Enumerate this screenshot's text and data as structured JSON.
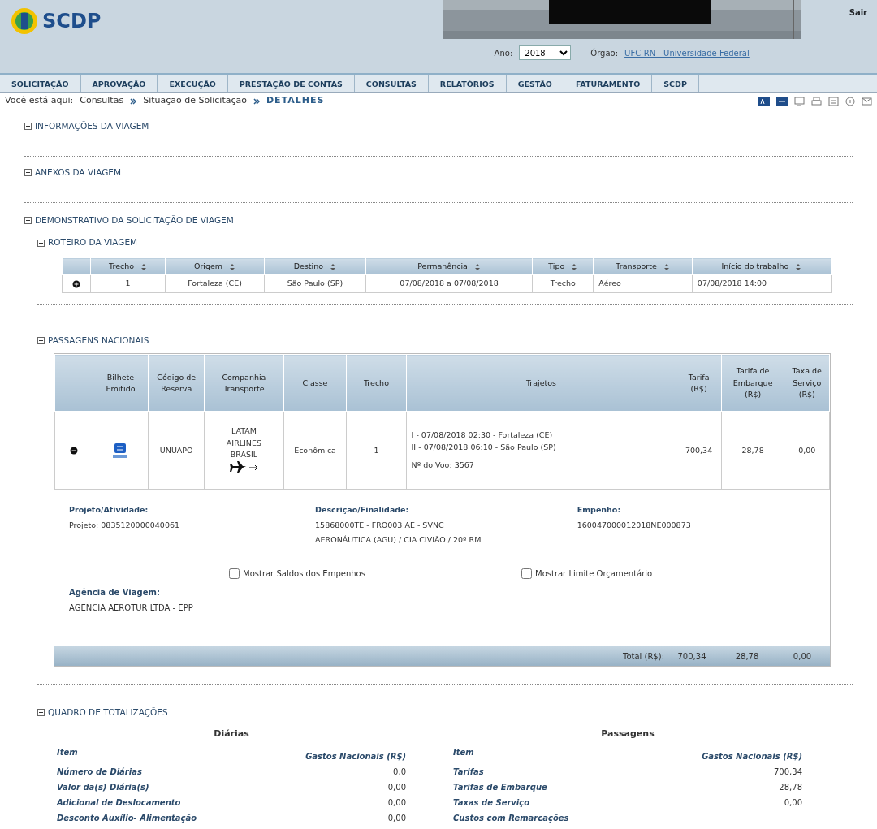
{
  "header": {
    "logo_text": "SCDP",
    "logout": "Sair",
    "year_label": "Ano:",
    "year": "2018",
    "org_label": "Órgão:",
    "org": "UFC-RN - Universidade Federal"
  },
  "menu": [
    "SOLICITAÇÃO",
    "APROVAÇÃO",
    "EXECUÇÃO",
    "PRESTAÇÃO DE CONTAS",
    "CONSULTAS",
    "RELATÓRIOS",
    "GESTÃO",
    "FATURAMENTO",
    "SCDP"
  ],
  "breadcrumb": {
    "label": "Você está aqui:",
    "items": [
      "Consultas",
      "Situação de Solicitação"
    ],
    "current": "DETALHES"
  },
  "sections": [
    {
      "title": "INFORMAÇÕES DA VIAGEM",
      "expanded": false
    },
    {
      "title": "ANEXOS DA VIAGEM",
      "expanded": false
    },
    {
      "title": "DEMONSTRATIVO DA SOLICITAÇÃO DE VIAGEM",
      "expanded": true
    }
  ],
  "itinerary": {
    "title": "ROTEIRO DA VIAGEM",
    "expanded": true,
    "columns": [
      "Trecho",
      "Origem",
      "Destino",
      "Permanência",
      "Tipo",
      "Transporte",
      "Início do trabalho"
    ],
    "rows": [
      {
        "expanded": false,
        "cells": [
          "1",
          "Fortaleza (CE)",
          "São Paulo (SP)",
          "07/08/2018 a 07/08/2018",
          "Trecho",
          "Aéreo",
          "07/08/2018 14:00"
        ]
      }
    ]
  },
  "tickets": {
    "title": "PASSAGENS NACIONAIS",
    "expanded": true,
    "columns": [
      "Bilhete Emitido",
      "Código de Reserva",
      "Companhia Transporte",
      "Classe",
      "Trecho",
      "Trajetos",
      "Tarifa (R$)",
      "Tarifa de Embarque (R$)",
      "Taxa de Serviço (R$)"
    ],
    "rows": [
      {
        "expanded": true,
        "issued": true,
        "code": "UNUAPO",
        "company": "LATAM AIRLINES BRASIL",
        "class": "Econômica",
        "leg": "1",
        "routes": [
          "I - 07/08/2018 02:30 - Fortaleza (CE)",
          "II - 07/08/2018 06:10 - São Paulo (SP)"
        ],
        "flight": "Nº do Voo: 3567",
        "fare": "700,34",
        "boarding": "28,78",
        "service": "0,00"
      }
    ],
    "details": [
      {
        "label": "Projeto/Atividade:",
        "lines": [
          "Projeto: 0835120000040061"
        ]
      },
      {
        "label": "Descrição/Finalidade:",
        "lines": [
          "15868000TE - FRO003 AE - SVNC",
          "AERONÁUTICA (AGU) / CIA CIVIÃO / 20º RM"
        ]
      },
      {
        "label": "Empenho:",
        "lines": [
          "160047000012018NE000873"
        ]
      }
    ],
    "checks": [
      {
        "label": "Mostrar Saldos dos Empenhos",
        "checked": false
      },
      {
        "label": "Mostrar Limite Orçamentário",
        "checked": false
      }
    ],
    "agency_label": "Agência de Viagem:",
    "agency": "AGENCIA AEROTUR LTDA - EPP",
    "total_label": "Total (R$):",
    "totals": [
      "700,34",
      "28,78",
      "0,00"
    ]
  },
  "summary": {
    "title": "QUADRO DE TOTALIZAÇÕES",
    "expanded": true,
    "groups": [
      {
        "title": "Diárias",
        "item_header": "Item",
        "value_header": "Gastos Nacionais (R$)",
        "rows": [
          {
            "item": "Número de Diárias",
            "value": "0,0"
          },
          {
            "item": "Valor da(s) Diária(s)",
            "value": "0,00"
          },
          {
            "item": "Adicional de Deslocamento",
            "value": "0,00"
          },
          {
            "item": "Desconto Auxílio- Alimentação",
            "value": "0,00"
          }
        ]
      },
      {
        "title": "Passagens",
        "item_header": "Item",
        "value_header": "Gastos Nacionais (R$)",
        "rows": [
          {
            "item": "Tarifas",
            "value": "700,34"
          },
          {
            "item": "Tarifas de Embarque",
            "value": "28,78"
          },
          {
            "item": "Taxas de Serviço",
            "value": "0,00"
          },
          {
            "item": "Custos com Remarcações"
          }
        ]
      }
    ]
  }
}
